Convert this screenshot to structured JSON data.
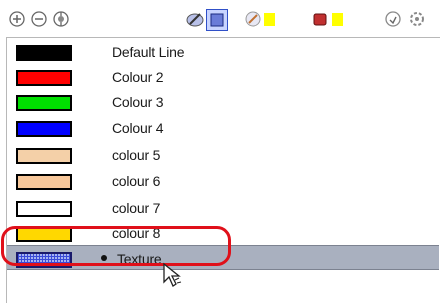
{
  "toolbar": {
    "buttons": [
      {
        "name": "add-colour-button",
        "icon": "plus-circle-icon"
      },
      {
        "name": "remove-colour-button",
        "icon": "minus-circle-icon"
      },
      {
        "name": "palette-options-button",
        "icon": "wheel-icon"
      },
      {
        "name": "edit-colour-button",
        "icon": "pencil-icon"
      },
      {
        "name": "texture-mode-button",
        "icon": "square-icon"
      },
      {
        "name": "line-colour-button",
        "icon": "brush-icon"
      },
      {
        "name": "fill-colour-button",
        "icon": "bucket-icon"
      },
      {
        "name": "lock-button",
        "icon": "lock-icon"
      },
      {
        "name": "settings-button",
        "icon": "gear-icon"
      }
    ],
    "accent_yellow": "#ffff00"
  },
  "colours": [
    {
      "label": "Default Line",
      "color": "#000000"
    },
    {
      "label": "Colour 2",
      "color": "#ff0000"
    },
    {
      "label": "Colour 3",
      "color": "#00e000"
    },
    {
      "label": "Colour 4",
      "color": "#0000ff"
    },
    {
      "label": "colour 5",
      "color": "#f4d0a8"
    },
    {
      "label": "colour 6",
      "color": "#f7c79a"
    },
    {
      "label": "colour 7",
      "color": "#ffffff"
    },
    {
      "label": "colour 8",
      "color": "#ffd800"
    },
    {
      "label": "Texture",
      "color": "#a8b4f0",
      "texture": true,
      "selected": true
    }
  ],
  "highlight_color": "#e0101a",
  "selection_color": "#a9b0bf"
}
